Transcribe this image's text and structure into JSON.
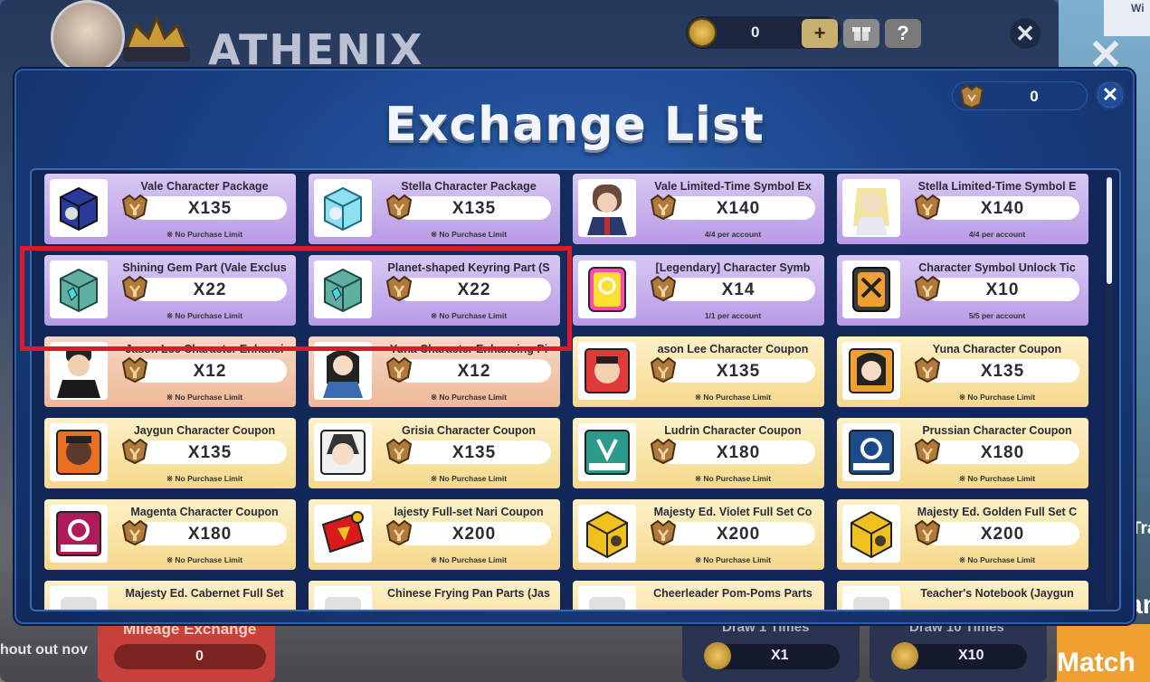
{
  "background": {
    "game_logo": "ATHENIX",
    "currency_value": "0",
    "add_button": "+",
    "gift_button": "gift",
    "help_button": "?",
    "close_button": "✕",
    "right_edge_texts": {
      "top": "Wi",
      "middle": "Tra",
      "bottom": "an"
    },
    "mileage_exchange": {
      "label": "Mileage Exchange",
      "value": "0"
    },
    "shout_text": "hout out nov",
    "draw1": {
      "label": "Draw 1 Times",
      "value": "X1"
    },
    "draw10": {
      "label": "Draw 10 Times",
      "value": "X10"
    },
    "match_label": "Match"
  },
  "modal": {
    "title": "Exchange List",
    "balance_value": "0",
    "close_label": "✕"
  },
  "colors": {
    "purple_card": "#c6b0ee",
    "peach_card": "#f2c4a8",
    "yellow_card": "#f9e3a0",
    "highlight": "#e0182c",
    "modal_blue": "#1b4287"
  },
  "items": [
    {
      "name": "Vale Character Package",
      "price": "X135",
      "limit": "※ No Purchase Limit",
      "tier": "purple",
      "icon": "blue-cube-icon"
    },
    {
      "name": "Stella Character Package",
      "price": "X135",
      "limit": "※ No Purchase Limit",
      "tier": "purple",
      "icon": "cyan-cube-icon"
    },
    {
      "name": "Vale Limited-Time Symbol Ex",
      "price": "X140",
      "limit": "4/4 per account",
      "tier": "purple",
      "icon": "vale-portrait-icon"
    },
    {
      "name": "Stella Limited-Time Symbol E",
      "price": "X140",
      "limit": "4/4 per account",
      "tier": "purple",
      "icon": "stella-portrait-icon"
    },
    {
      "name": "Shining Gem Part (Vale Exclus",
      "price": "X22",
      "limit": "※ No Purchase Limit",
      "tier": "purple",
      "icon": "green-cube-icon"
    },
    {
      "name": "Planet-shaped Keyring Part (S",
      "price": "X22",
      "limit": "※ No Purchase Limit",
      "tier": "purple",
      "icon": "green-cube-icon"
    },
    {
      "name": "[Legendary] Character Symb",
      "price": "X14",
      "limit": "1/1 per account",
      "tier": "purple",
      "icon": "legendary-symbol-icon"
    },
    {
      "name": "Character Symbol Unlock Tic",
      "price": "X10",
      "limit": "5/5 per account",
      "tier": "purple",
      "icon": "unlock-ticket-icon"
    },
    {
      "name": "Jason Lee Character Enhanci",
      "price": "X12",
      "limit": "※ No Purchase Limit",
      "tier": "peach",
      "icon": "jason-portrait-icon"
    },
    {
      "name": "Yuna Character Enhancing Pi",
      "price": "X12",
      "limit": "※ No Purchase Limit",
      "tier": "peach",
      "icon": "yuna-portrait-icon"
    },
    {
      "name": "ason Lee Character Coupon",
      "price": "X135",
      "limit": "※ No Purchase Limit",
      "tier": "yellow",
      "icon": "jason-coupon-icon"
    },
    {
      "name": "Yuna Character Coupon",
      "price": "X135",
      "limit": "※ No Purchase Limit",
      "tier": "yellow",
      "icon": "yuna-coupon-icon"
    },
    {
      "name": "Jaygun Character Coupon",
      "price": "X135",
      "limit": "※ No Purchase Limit",
      "tier": "yellow",
      "icon": "jaygun-coupon-icon"
    },
    {
      "name": "Grisia Character Coupon",
      "price": "X135",
      "limit": "※ No Purchase Limit",
      "tier": "yellow",
      "icon": "grisia-coupon-icon"
    },
    {
      "name": "Ludrin Character Coupon",
      "price": "X180",
      "limit": "※ No Purchase Limit",
      "tier": "yellow",
      "icon": "ludrin-coupon-icon"
    },
    {
      "name": "Prussian Character Coupon",
      "price": "X180",
      "limit": "※ No Purchase Limit",
      "tier": "yellow",
      "icon": "prussian-coupon-icon"
    },
    {
      "name": "Magenta Character Coupon",
      "price": "X180",
      "limit": "※ No Purchase Limit",
      "tier": "yellow",
      "icon": "magenta-coupon-icon"
    },
    {
      "name": "lajesty Full-set Nari Coupon",
      "price": "X200",
      "limit": "※ No Purchase Limit",
      "tier": "yellow",
      "icon": "red-ticket-icon"
    },
    {
      "name": "Majesty Ed. Violet  Full Set Co",
      "price": "X200",
      "limit": "※ No Purchase Limit",
      "tier": "yellow",
      "icon": "gold-box-icon"
    },
    {
      "name": "Majesty Ed. Golden Full Set C",
      "price": "X200",
      "limit": "※ No Purchase Limit",
      "tier": "yellow",
      "icon": "gold-box-icon"
    },
    {
      "name": "Majesty Ed. Cabernet Full Set",
      "price": "",
      "limit": "",
      "tier": "yellow",
      "icon": "item-icon"
    },
    {
      "name": "Chinese Frying Pan Parts (Jas",
      "price": "",
      "limit": "",
      "tier": "yellow",
      "icon": "item-icon"
    },
    {
      "name": "Cheerleader Pom-Poms Parts",
      "price": "",
      "limit": "",
      "tier": "yellow",
      "icon": "item-icon"
    },
    {
      "name": "Teacher's Notebook (Jaygun",
      "price": "",
      "limit": "",
      "tier": "yellow",
      "icon": "item-icon"
    }
  ]
}
